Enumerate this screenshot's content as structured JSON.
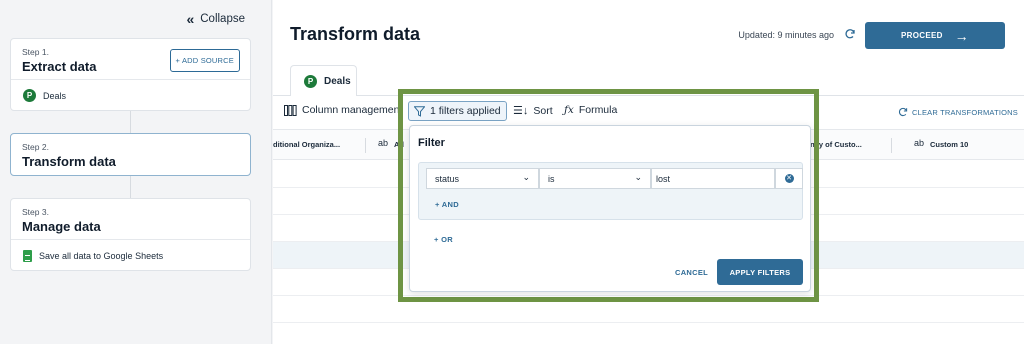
{
  "sidebar": {
    "collapse_label": "Collapse",
    "steps": [
      {
        "number": "Step 1.",
        "title": "Extract data",
        "action": "+ ADD SOURCE",
        "item": "Deals"
      },
      {
        "number": "Step 2.",
        "title": "Transform data"
      },
      {
        "number": "Step 3.",
        "title": "Manage data",
        "item": "Save all data to Google Sheets"
      }
    ]
  },
  "header": {
    "title": "Transform data",
    "updated": "Updated: 9 minutes ago",
    "proceed_label": "PROCEED"
  },
  "tabs": [
    {
      "label": "Deals",
      "badge": "P"
    }
  ],
  "toolbar": {
    "column_management": "Column management",
    "filters_applied": "1 filters applied",
    "sort": "Sort",
    "formula": "Formula",
    "clear": "CLEAR TRANSFORMATIONS"
  },
  "columns": [
    {
      "type": "",
      "label": "ditional Organiza..."
    },
    {
      "type": "ab",
      "label": "Ad"
    },
    {
      "type": "",
      "label": "ency of Custo..."
    },
    {
      "type": "ab",
      "label": "Custom 10"
    }
  ],
  "filter": {
    "title": "Filter",
    "field": "status",
    "operator": "is",
    "value": "lost",
    "and_label": "+ AND",
    "or_label": "+ OR",
    "cancel_label": "CANCEL",
    "apply_label": "APPLY FILTERS"
  },
  "colors": {
    "accent": "#2f6b96",
    "highlight_frame": "#6e9444",
    "brand_badge": "#1d7a3a"
  }
}
